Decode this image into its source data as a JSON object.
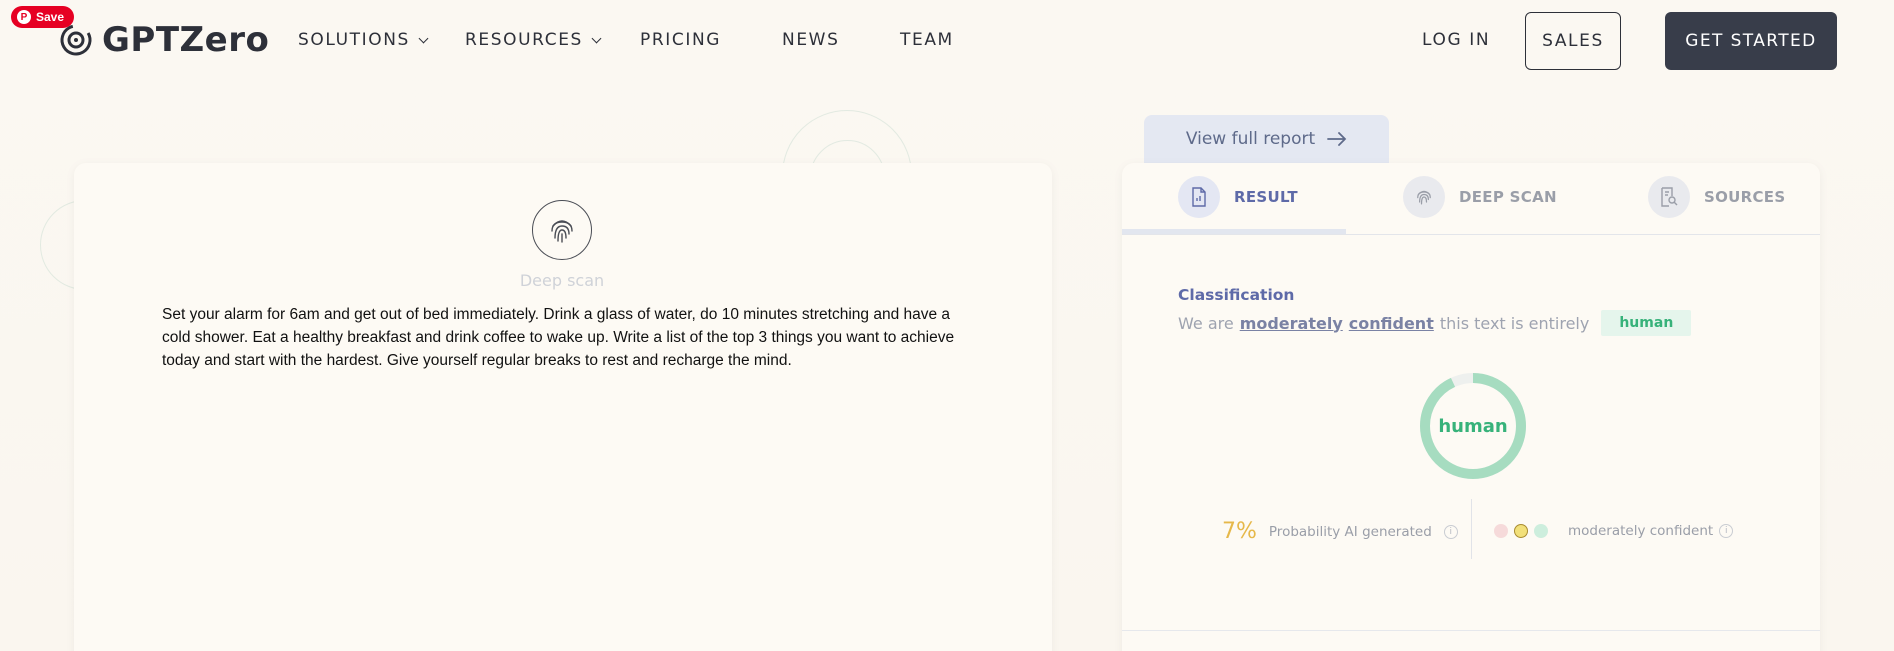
{
  "pinterest": {
    "save_label": "Save"
  },
  "header": {
    "logo_text": "GPTZero",
    "nav": [
      {
        "label": "SOLUTIONS",
        "has_dropdown": true
      },
      {
        "label": "RESOURCES",
        "has_dropdown": true
      },
      {
        "label": "PRICING",
        "has_dropdown": false
      },
      {
        "label": "NEWS",
        "has_dropdown": false
      },
      {
        "label": "TEAM",
        "has_dropdown": false
      }
    ],
    "login_label": "LOG IN",
    "sales_label": "SALES",
    "get_started_label": "GET STARTED"
  },
  "editor": {
    "icon": "fingerprint-icon",
    "scan_label": "Deep scan",
    "text": "Set your alarm for 6am and get out of bed immediately. Drink a glass of water, do 10 minutes stretching and have a cold shower. Eat a healthy breakfast and drink coffee to wake up. Write a list of the top 3 things you want to achieve today and start with the hardest. Give yourself regular breaks to rest and recharge the mind."
  },
  "report": {
    "view_full_report_label": "View full report",
    "tabs": [
      {
        "label": "RESULT",
        "icon": "document-icon",
        "active": true
      },
      {
        "label": "DEEP SCAN",
        "icon": "fingerprint-icon",
        "active": false
      },
      {
        "label": "SOURCES",
        "icon": "search-document-icon",
        "active": false
      }
    ],
    "classification_title": "Classification",
    "classification_prefix": "We are",
    "confidence_word_1": "moderately",
    "confidence_word_2": "confident",
    "classification_suffix": "this text is entirely",
    "classification_badge": "human",
    "ring_label": "human",
    "human_fraction": 0.93,
    "probability_value": "7%",
    "probability_label": "Probability AI generated",
    "confidence_label": "moderately confident",
    "colors": {
      "accent": "#5e6aa8",
      "human": "#37b27a",
      "ring_human": "#a6dcc0",
      "ai_prob": "#e6b84a",
      "dot_red": "#f6dada",
      "dot_yellow": "#f2e07a",
      "dot_green": "#cdeedd"
    }
  }
}
